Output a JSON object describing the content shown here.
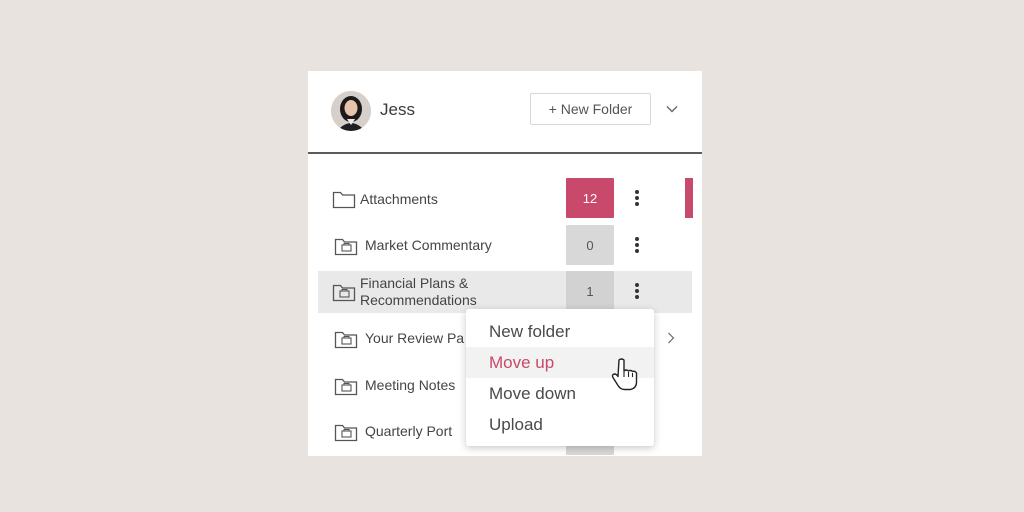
{
  "header": {
    "user_name": "Jess",
    "new_folder_label": "+ New Folder"
  },
  "folders": [
    {
      "label": "Attachments",
      "count": "12"
    },
    {
      "label": "Market Commentary",
      "count": "0"
    },
    {
      "label": "Financial Plans &",
      "label_line2": "Recommendations",
      "count": "1"
    },
    {
      "label": "Your Review Pa",
      "count": ""
    },
    {
      "label": "Meeting Notes",
      "count": ""
    },
    {
      "label": "Quarterly Port",
      "count": ""
    }
  ],
  "context_menu": {
    "items": [
      "New folder",
      "Move up",
      "Move down",
      "Upload"
    ],
    "active_item": "Move up"
  },
  "colors": {
    "accent": "#c8496b",
    "badge_gray": "#d8d8d8",
    "background": "#e8e3df"
  }
}
